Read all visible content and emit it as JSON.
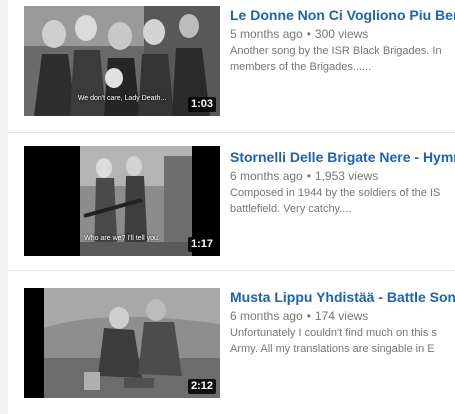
{
  "videos": [
    {
      "title": "Le Donne Non Ci Vogliono Piu Bene",
      "age": "5 months ago",
      "views": "300 views",
      "separator": "•",
      "description_line1": "Another song by the ISR Black Brigades. In",
      "description_line2": "members of the Brigades......",
      "duration": "1:03",
      "caption": "We don't care, Lady Death..."
    },
    {
      "title": "Stornelli Delle Brigate Nere - Hymn C",
      "age": "6 months ago",
      "views": "1,953 views",
      "separator": "•",
      "description_line1": "Composed in 1944 by the soldiers of the IS",
      "description_line2": "battlefield. Very catchy....",
      "duration": "1:17",
      "caption": "Who are we? I'll tell you."
    },
    {
      "title": "Musta Lippu Yhdistää - Battle Song",
      "age": "6 months ago",
      "views": "174 views",
      "separator": "•",
      "description_line1": "Unfortunately I couldn't find much on this s",
      "description_line2": "Army. All my translations are singable in E",
      "duration": "2:12",
      "caption": ""
    }
  ]
}
